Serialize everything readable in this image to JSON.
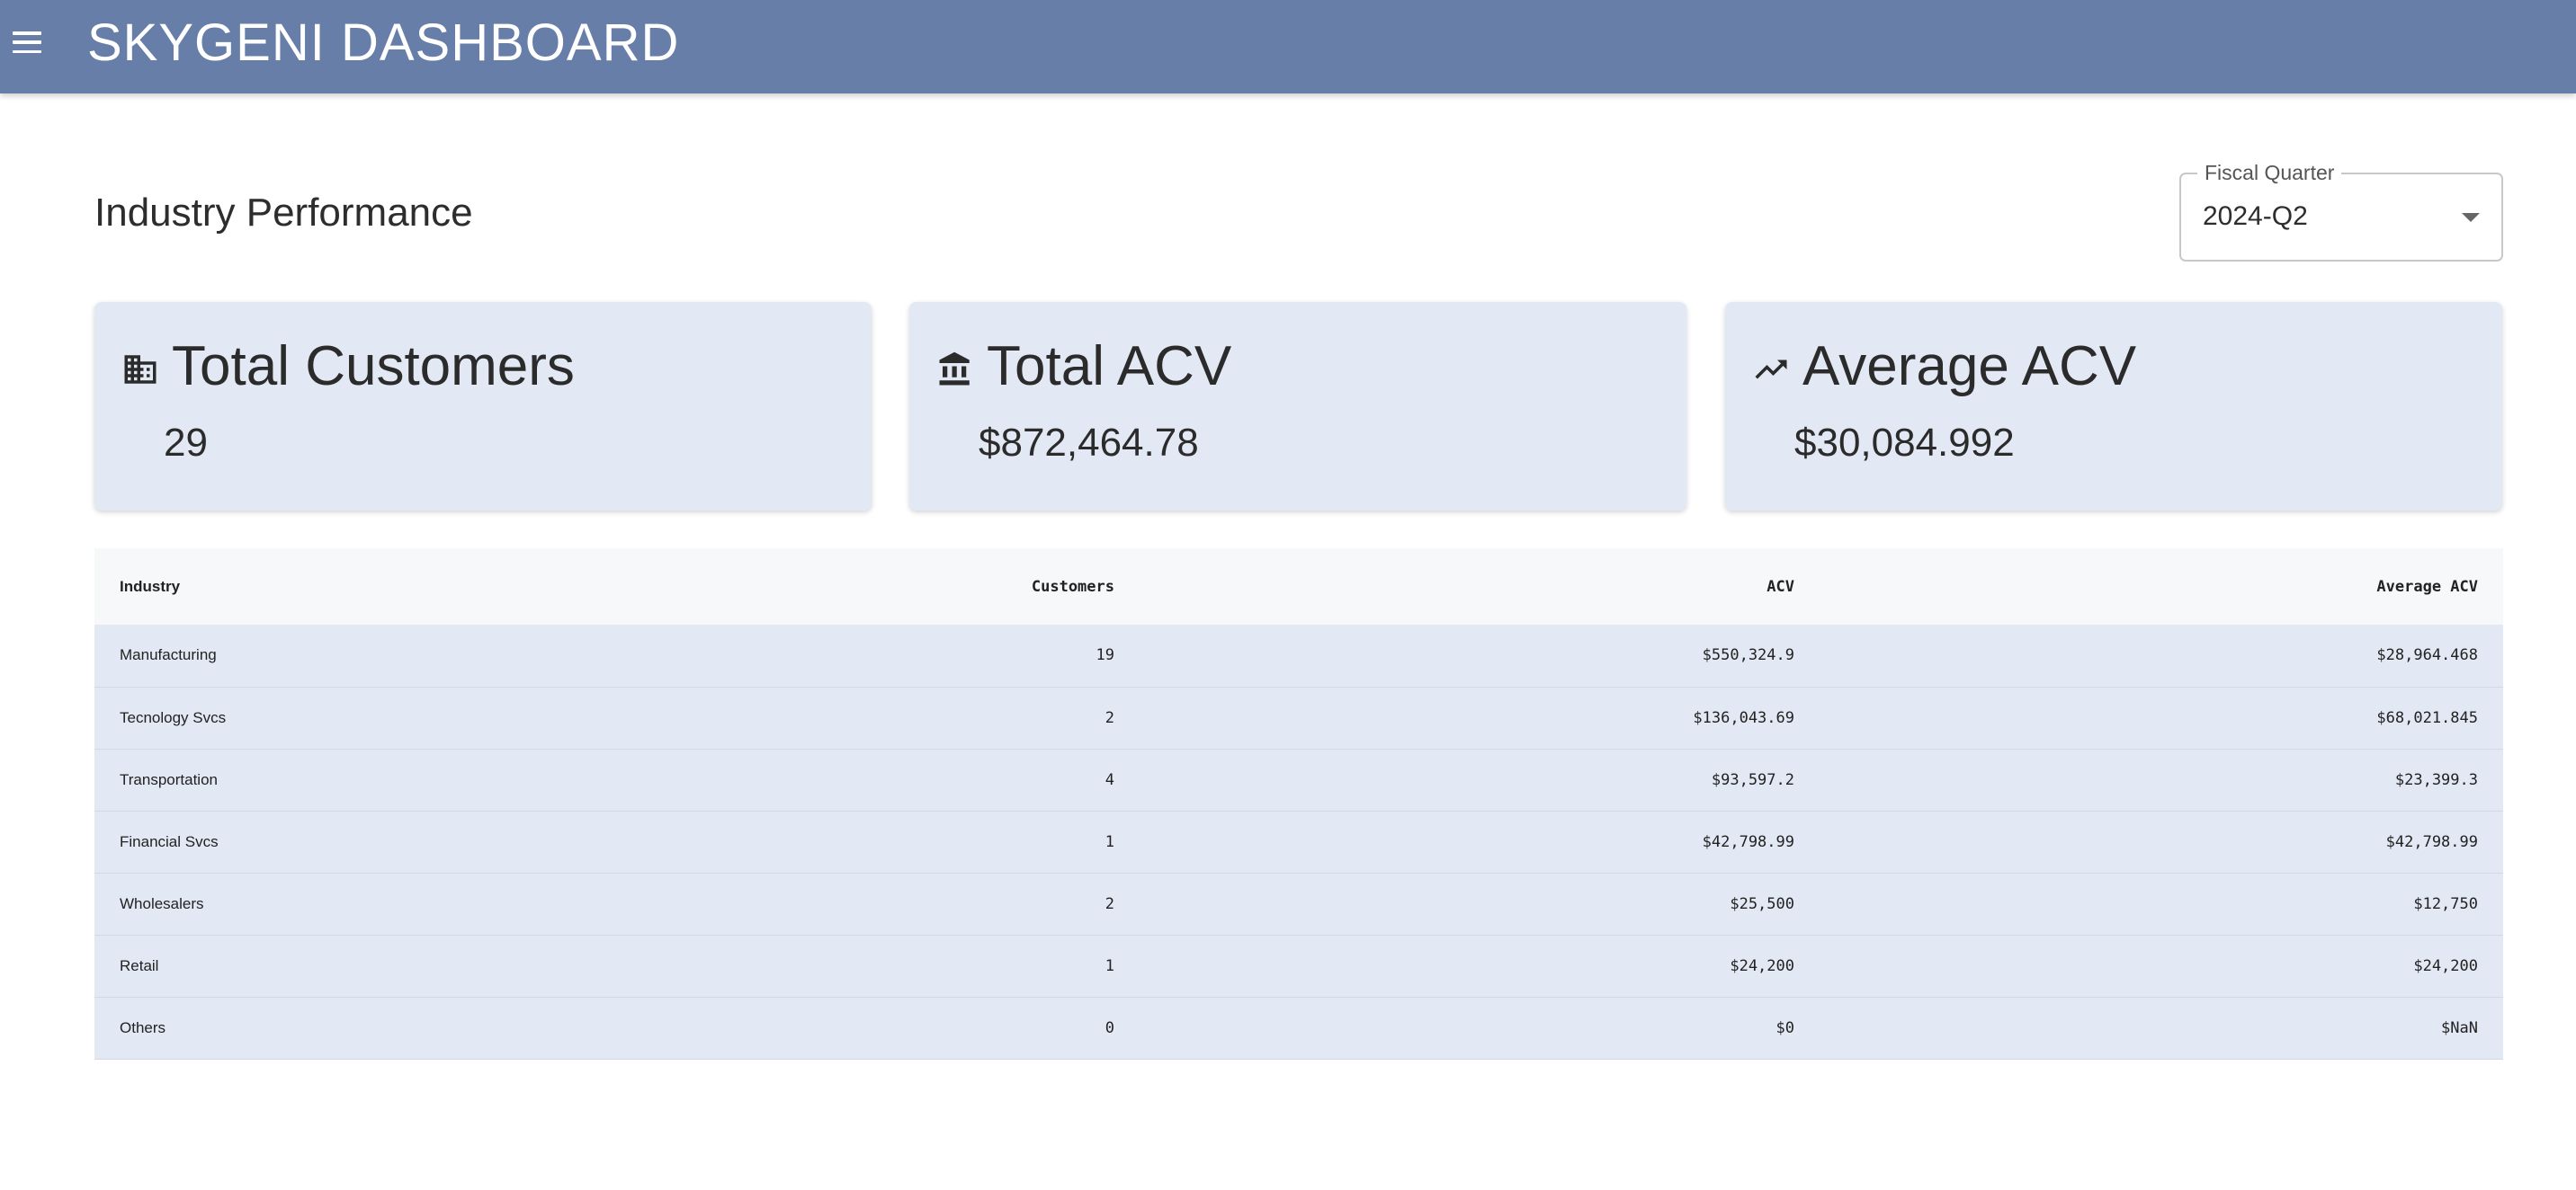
{
  "header": {
    "title": "SKYGENI DASHBOARD",
    "menu_icon": "menu-icon"
  },
  "page": {
    "title": "Industry Performance"
  },
  "fiscal_quarter": {
    "label": "Fiscal Quarter",
    "value": "2024-Q2"
  },
  "cards": [
    {
      "icon": "building-icon",
      "title": "Total Customers",
      "value": "29"
    },
    {
      "icon": "bank-icon",
      "title": "Total ACV",
      "value": "$872,464.78"
    },
    {
      "icon": "trending-up-icon",
      "title": "Average ACV",
      "value": "$30,084.992"
    }
  ],
  "table": {
    "headers": [
      "Industry",
      "Customers",
      "ACV",
      "Average ACV"
    ],
    "rows": [
      [
        "Manufacturing",
        "19",
        "$550,324.9",
        "$28,964.468"
      ],
      [
        "Tecnology Svcs",
        "2",
        "$136,043.69",
        "$68,021.845"
      ],
      [
        "Transportation",
        "4",
        "$93,597.2",
        "$23,399.3"
      ],
      [
        "Financial Svcs",
        "1",
        "$42,798.99",
        "$42,798.99"
      ],
      [
        "Wholesalers",
        "2",
        "$25,500",
        "$12,750"
      ],
      [
        "Retail",
        "1",
        "$24,200",
        "$24,200"
      ],
      [
        "Others",
        "0",
        "$0",
        "$NaN"
      ]
    ]
  },
  "colors": {
    "appbar": "#667ea8",
    "card_bg": "#e3e9f4",
    "table_header_bg": "#f7f8f9"
  }
}
